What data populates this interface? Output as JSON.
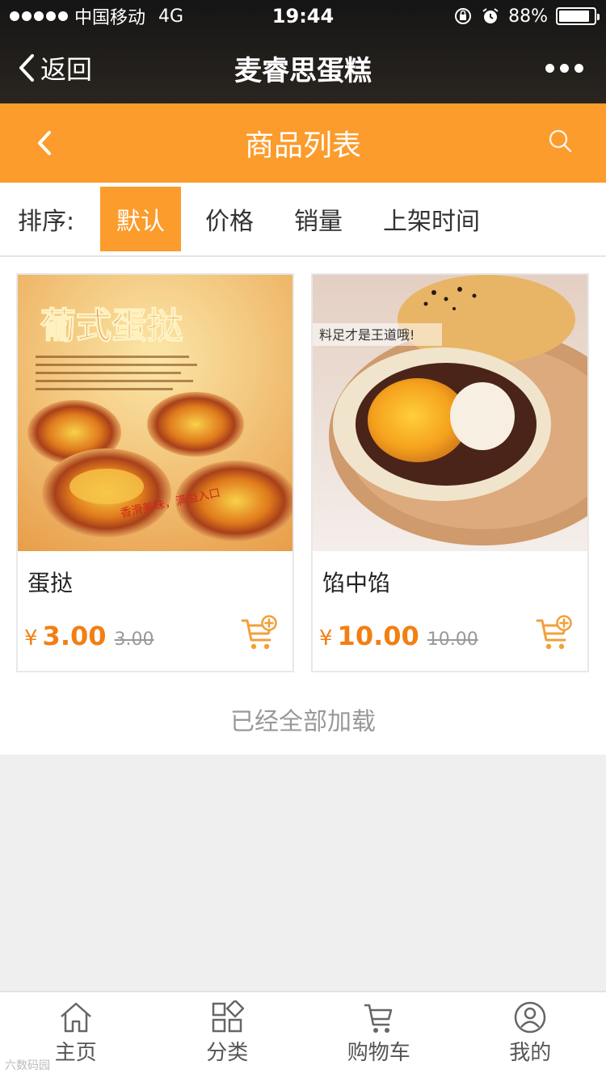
{
  "status_bar": {
    "carrier": "中国移动",
    "network": "4G",
    "time": "19:44",
    "battery": "88%",
    "battery_level": 0.88
  },
  "wechat_nav": {
    "back_label": "返回",
    "title": "麦睿思蛋糕"
  },
  "header": {
    "title": "商品列表"
  },
  "sort": {
    "label": "排序:",
    "options": [
      "默认",
      "价格",
      "销量",
      "上架时间"
    ],
    "active": "默认"
  },
  "products": [
    {
      "name": "蛋挞",
      "currency": "¥",
      "price": "3.00",
      "old_price": "3.00",
      "image_title": "葡式蛋挞",
      "image_slogan": "香滑美味，满溢入口"
    },
    {
      "name": "馅中馅",
      "currency": "¥",
      "price": "10.00",
      "old_price": "10.00",
      "image_caption": "料足才是王道哦!"
    }
  ],
  "load_status": "已经全部加载",
  "tabs": [
    {
      "label": "主页",
      "icon": "home-icon"
    },
    {
      "label": "分类",
      "icon": "category-icon"
    },
    {
      "label": "购物车",
      "icon": "cart-icon"
    },
    {
      "label": "我的",
      "icon": "user-icon"
    }
  ],
  "watermark": "六数码园",
  "colors": {
    "accent": "#fb9c2c",
    "price": "#f27f12"
  }
}
